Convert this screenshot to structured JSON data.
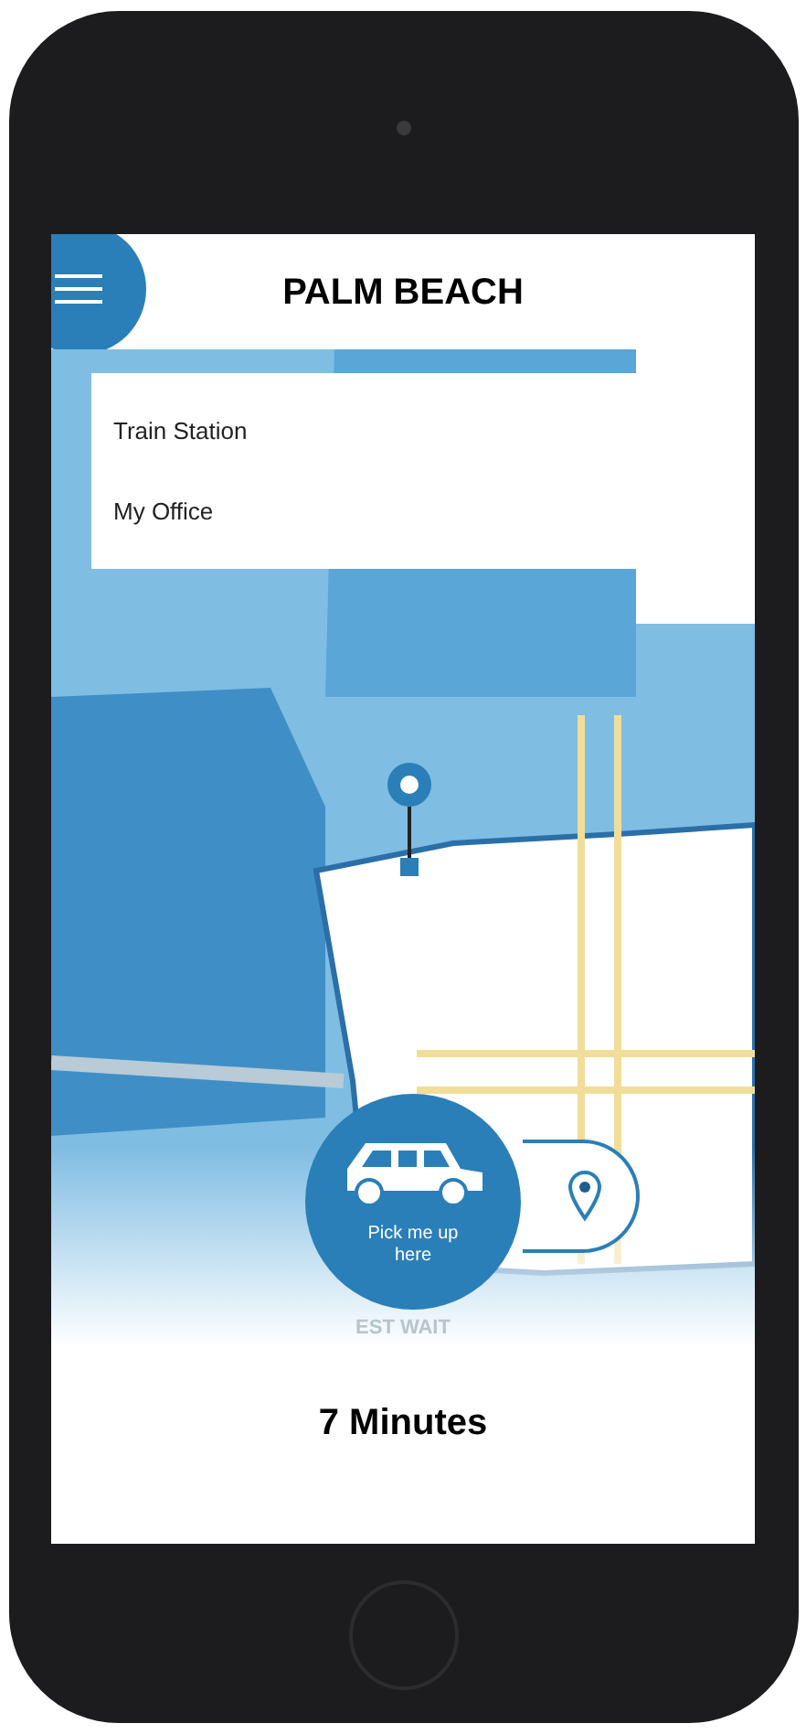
{
  "header": {
    "title": "PALM BEACH"
  },
  "suggestions": [
    {
      "label": "Train Station"
    },
    {
      "label": "My Office"
    }
  ],
  "pickup_button": {
    "label": "Pick me up here"
  },
  "wait": {
    "label": "EST WAIT",
    "value": "7 Minutes"
  }
}
